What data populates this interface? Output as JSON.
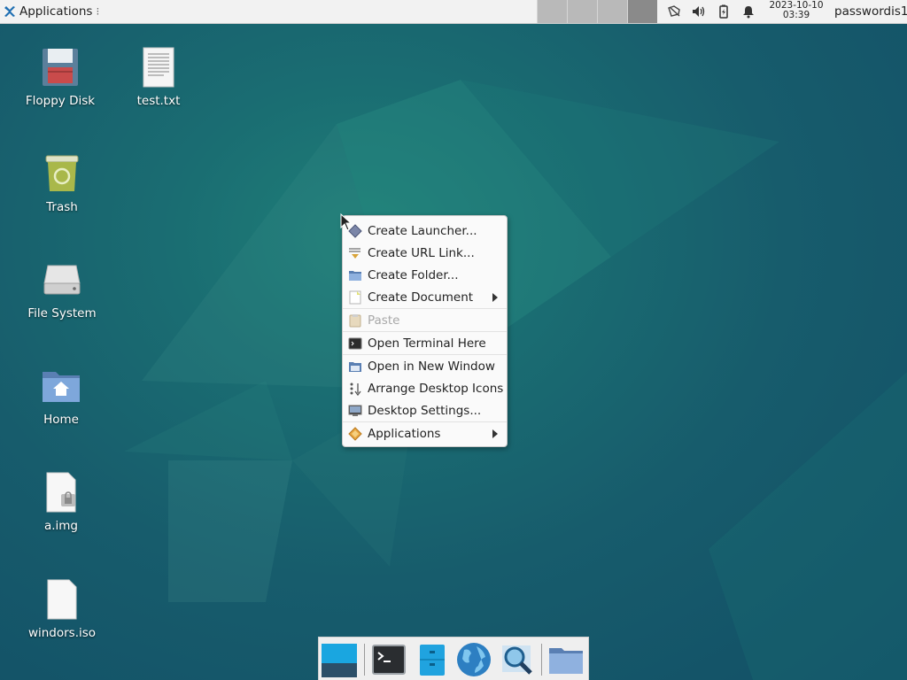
{
  "top_panel": {
    "applications_label": "Applications",
    "clock_date": "2023-10-10",
    "clock_time": "03:39",
    "user": "passwordis1"
  },
  "desktop_icons": [
    {
      "label": "Floppy Disk",
      "icon": "floppy-disk-icon"
    },
    {
      "label": "test.txt",
      "icon": "text-file-icon"
    },
    {
      "label": "Trash",
      "icon": "trash-icon"
    },
    {
      "label": "File System",
      "icon": "hard-drive-icon"
    },
    {
      "label": "Home",
      "icon": "home-folder-icon"
    },
    {
      "label": "a.img",
      "icon": "locked-file-icon"
    },
    {
      "label": "windors.iso",
      "icon": "file-icon"
    }
  ],
  "context_menu": {
    "items": [
      {
        "label": "Create Launcher...",
        "icon": "launcher-icon"
      },
      {
        "label": "Create URL Link...",
        "icon": "url-link-icon"
      },
      {
        "label": "Create Folder...",
        "icon": "folder-icon"
      },
      {
        "label": "Create Document",
        "icon": "document-icon",
        "submenu": true
      },
      {
        "label": "Paste",
        "icon": "paste-icon",
        "disabled": true
      },
      {
        "label": "Open Terminal Here",
        "icon": "terminal-icon"
      },
      {
        "label": "Open in New Window",
        "icon": "window-icon"
      },
      {
        "label": "Arrange Desktop Icons",
        "icon": "arrange-icon"
      },
      {
        "label": "Desktop Settings...",
        "icon": "settings-icon"
      },
      {
        "label": "Applications",
        "icon": "applications-icon",
        "submenu": true
      }
    ]
  },
  "dock": {
    "items": [
      {
        "name": "show-desktop",
        "icon": "show-desktop-icon"
      },
      {
        "name": "terminal",
        "icon": "terminal-icon"
      },
      {
        "name": "file-manager",
        "icon": "file-manager-icon"
      },
      {
        "name": "web-browser",
        "icon": "globe-icon"
      },
      {
        "name": "app-finder",
        "icon": "magnifier-icon"
      },
      {
        "name": "folder",
        "icon": "folder-icon"
      }
    ]
  },
  "colors": {
    "desktop_bg": "#175c6c",
    "panel_bg": "#f2f2f2",
    "menu_bg": "#fafafa"
  }
}
